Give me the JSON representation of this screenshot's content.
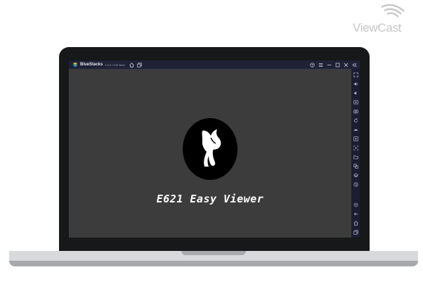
{
  "watermark": {
    "brand": "ViewCast",
    "icon": "broadcast-waves-icon"
  },
  "emulator": {
    "brand": "BlueStacks",
    "version": "5.0.0.7228 Beta",
    "titlebar_left_icons": [
      "home-icon",
      "multi-instance-icon"
    ],
    "titlebar_right_icons": [
      "help-icon",
      "menu-icon",
      "minimize-icon",
      "restore-icon",
      "close-icon",
      "collapse-sidebar-icon"
    ],
    "sidebar_icons_top": [
      "fullscreen-icon",
      "volume-up-icon",
      "volume-down-icon",
      "screen-record-icon",
      "screenshot-icon",
      "rotate-icon",
      "shake-icon",
      "controls-icon",
      "macro-icon",
      "folder-icon",
      "multi-instance-manager-icon",
      "eco-mode-icon",
      "sync-icon"
    ],
    "sidebar_icons_bottom": [
      "settings-icon",
      "back-icon",
      "home-nav-icon",
      "recent-apps-icon"
    ]
  },
  "app": {
    "title": "E621 Easy Viewer",
    "logo": "white-fox-silhouette-logo",
    "background": "#3c3c3d"
  }
}
